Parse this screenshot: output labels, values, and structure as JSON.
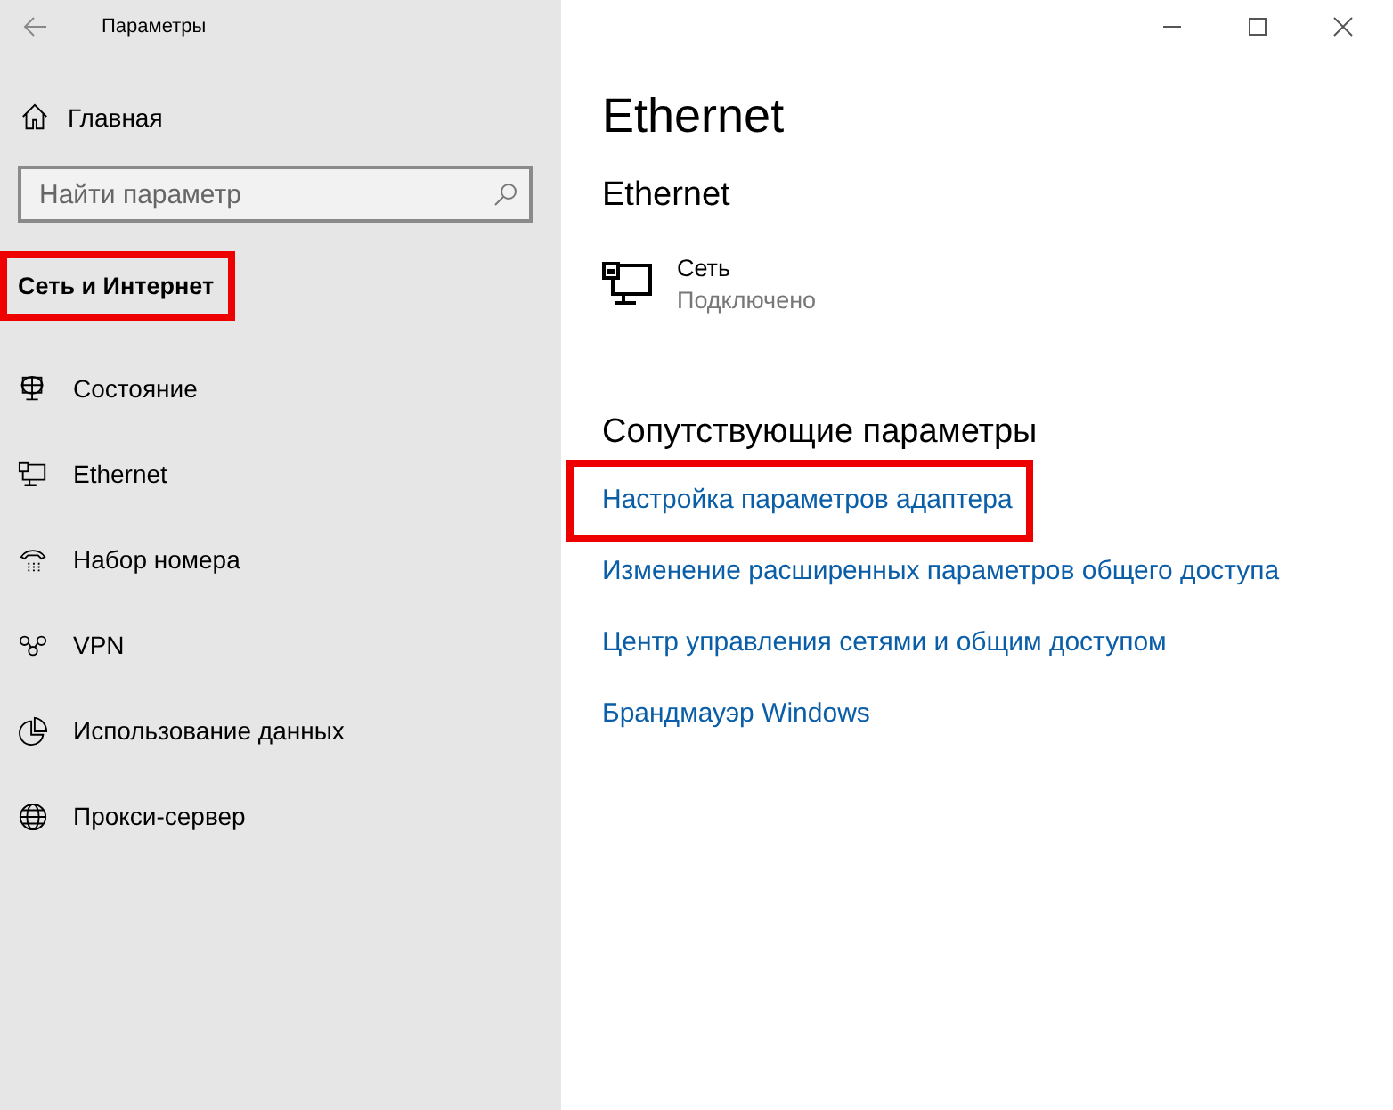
{
  "window": {
    "title": "Параметры"
  },
  "sidebar": {
    "home": "Главная",
    "search": {
      "placeholder": "Найти параметр"
    },
    "category": {
      "label": "Сеть и Интернет",
      "highlight": true
    },
    "items": [
      {
        "kind": "status",
        "label": "Состояние"
      },
      {
        "kind": "ethernet",
        "label": "Ethernet"
      },
      {
        "kind": "dialup",
        "label": "Набор номера"
      },
      {
        "kind": "vpn",
        "label": "VPN"
      },
      {
        "kind": "data",
        "label": "Использование данных"
      },
      {
        "kind": "proxy",
        "label": "Прокси-сервер"
      }
    ]
  },
  "main": {
    "title": "Ethernet",
    "subtitle": "Ethernet",
    "network": {
      "name": "Сеть",
      "status": "Подключено"
    },
    "related": {
      "heading": "Сопутствующие параметры",
      "links": [
        {
          "label": "Настройка параметров адаптера",
          "highlight": true
        },
        {
          "label": "Изменение расширенных параметров общего доступа",
          "highlight": false
        },
        {
          "label": "Центр управления сетями и общим доступом",
          "highlight": false
        },
        {
          "label": "Брандмауэр Windows",
          "highlight": false
        }
      ]
    }
  }
}
